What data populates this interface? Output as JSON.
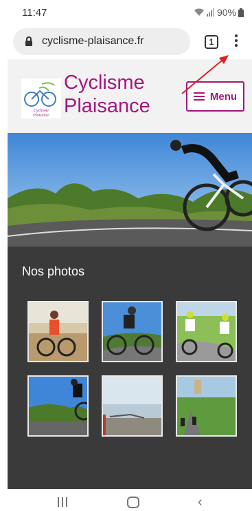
{
  "status": {
    "time": "11:47",
    "battery": "90%"
  },
  "browser": {
    "url": "cyclisme-plaisance.fr",
    "tab_count": "1"
  },
  "header": {
    "title_line1": "Cyclisme",
    "title_line2": "Plaisance",
    "menu_label": "Menu",
    "logo_text_line1": "Cyclisme",
    "logo_text_line2": "Plaisance"
  },
  "photos": {
    "title": "Nos photos",
    "items": [
      {
        "icon": "cyclist-photo-1"
      },
      {
        "icon": "cyclist-photo-2"
      },
      {
        "icon": "cyclist-photo-3"
      },
      {
        "icon": "cyclist-photo-4"
      },
      {
        "icon": "landscape-photo-5"
      },
      {
        "icon": "cyclist-photo-6"
      }
    ]
  },
  "colors": {
    "brand": "#a3177f",
    "annotation": "#e02020",
    "section_bg": "#3a3a3a"
  }
}
